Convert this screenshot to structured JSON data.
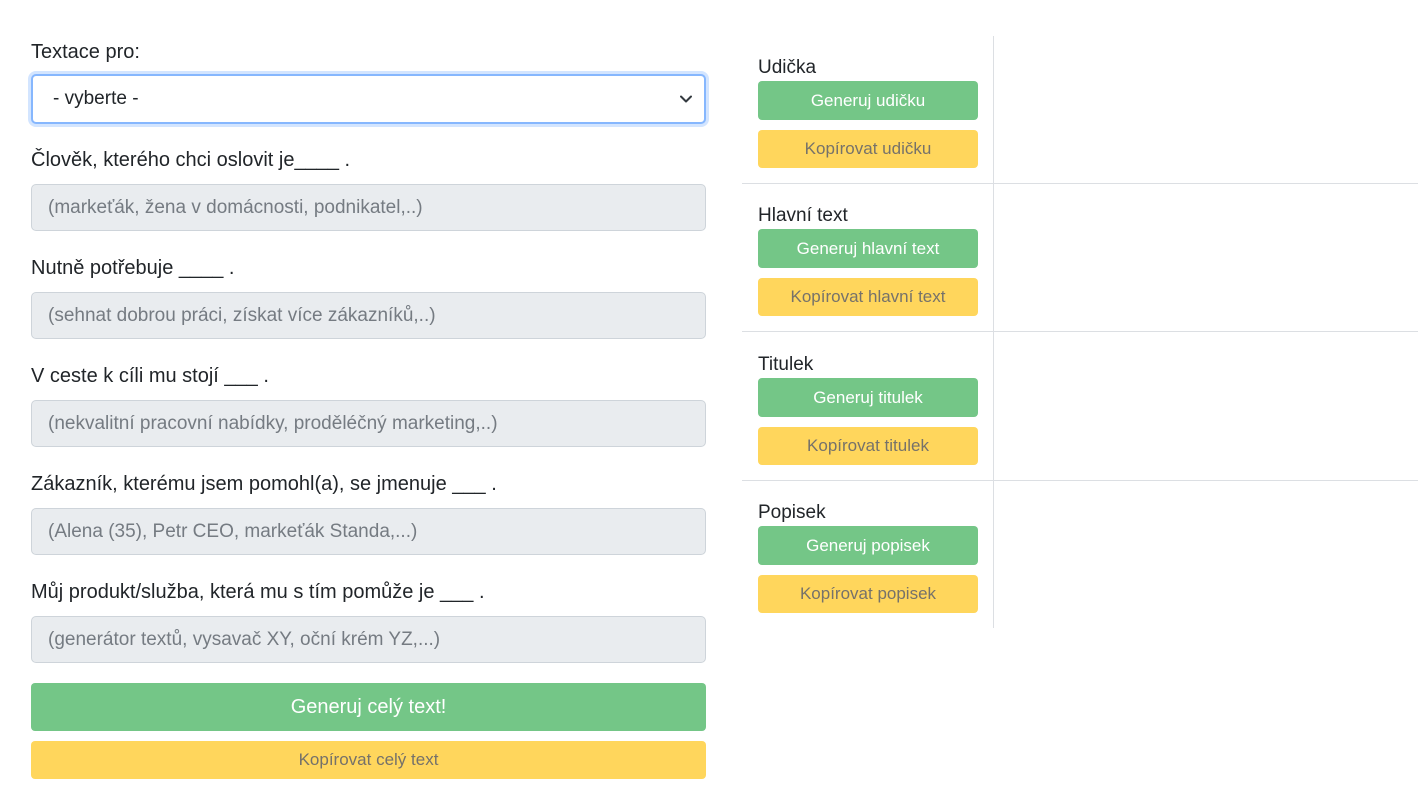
{
  "form": {
    "type_label": "Textace pro:",
    "type_select_value": "- vyberte -",
    "fields": [
      {
        "label": "Člověk, kterého chci oslovit je____ .",
        "placeholder": "(markeťák, žena v domácnosti, podnikatel,..)"
      },
      {
        "label": "Nutně potřebuje ____ .",
        "placeholder": "(sehnat dobrou práci, získat více zákazníků,..)"
      },
      {
        "label": "V ceste k cíli mu stojí ___ .",
        "placeholder": "(nekvalitní pracovní nabídky, proděléčný marketing,..)"
      },
      {
        "label": "Zákazník, kterému jsem pomohl(a), se jmenuje ___ .",
        "placeholder": "(Alena (35), Petr CEO, markeťák Standa,...)"
      },
      {
        "label": "Můj produkt/služba, která mu s tím pomůže je ___ .",
        "placeholder": "(generátor textů, vysavač XY, oční krém YZ,...)"
      }
    ],
    "generate_all_label": "Generuj celý text!",
    "copy_all_label": "Kopírovat celý text"
  },
  "sections": [
    {
      "title": "Udička",
      "generate_label": "Generuj udičku",
      "copy_label": "Kopírovat udičku"
    },
    {
      "title": "Hlavní text",
      "generate_label": "Generuj hlavní text",
      "copy_label": "Kopírovat hlavní text"
    },
    {
      "title": "Titulek",
      "generate_label": "Generuj titulek",
      "copy_label": "Kopírovat titulek"
    },
    {
      "title": "Popisek",
      "generate_label": "Generuj popisek",
      "copy_label": "Kopírovat popisek"
    }
  ],
  "colors": {
    "green": "#74c687",
    "yellow": "#ffd65c",
    "field_bg": "#e9ecef",
    "focus_border": "#86b7fe"
  },
  "icons": {
    "select_arrow": "chevron-down-icon"
  }
}
